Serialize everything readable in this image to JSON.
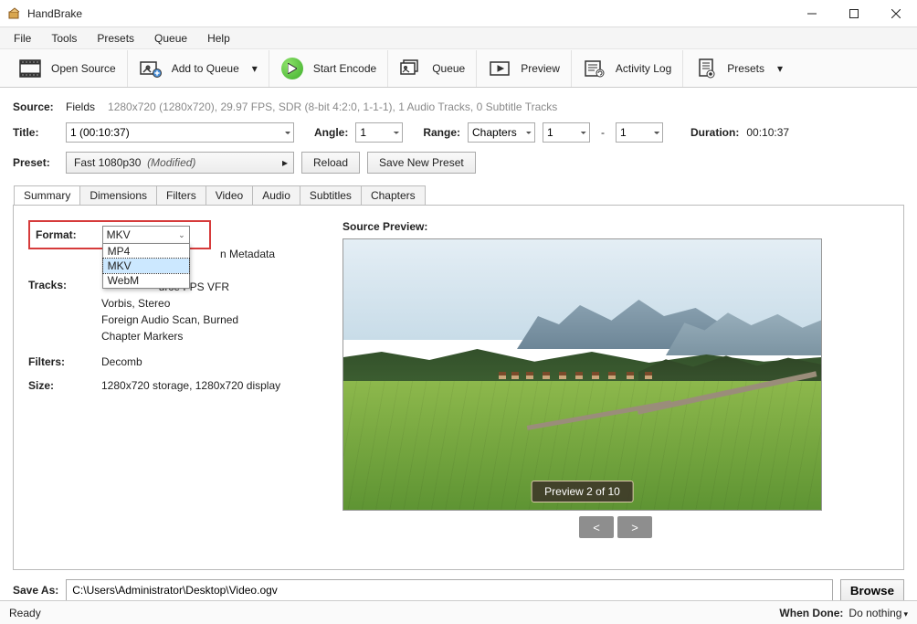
{
  "app": {
    "name": "HandBrake"
  },
  "menu": {
    "file": "File",
    "tools": "Tools",
    "presets": "Presets",
    "queue": "Queue",
    "help": "Help"
  },
  "toolbar": {
    "open_source": "Open Source",
    "add_to_queue": "Add to Queue",
    "start_encode": "Start Encode",
    "queue": "Queue",
    "preview": "Preview",
    "activity_log": "Activity Log",
    "presets": "Presets"
  },
  "source": {
    "label": "Source:",
    "name": "Fields",
    "info": "1280x720 (1280x720), 29.97 FPS, SDR (8-bit 4:2:0, 1-1-1), 1 Audio Tracks, 0 Subtitle Tracks"
  },
  "title_row": {
    "title_label": "Title:",
    "title_value": "1  (00:10:37)",
    "angle_label": "Angle:",
    "angle_value": "1",
    "range_label": "Range:",
    "range_type": "Chapters",
    "range_from": "1",
    "range_sep": "-",
    "range_to": "1",
    "duration_label": "Duration:",
    "duration_value": "00:10:37"
  },
  "preset": {
    "label": "Preset:",
    "name": "Fast 1080p30",
    "modified": "(Modified)",
    "reload": "Reload",
    "save_new": "Save New Preset"
  },
  "tabs": {
    "summary": "Summary",
    "dimensions": "Dimensions",
    "filters": "Filters",
    "video": "Video",
    "audio": "Audio",
    "subtitles": "Subtitles",
    "chapters": "Chapters"
  },
  "summary": {
    "format_label": "Format:",
    "format_value": "MKV",
    "format_options": {
      "mp4": "MP4",
      "mkv": "MKV",
      "webm": "WebM"
    },
    "passthru_metadata_partial": "n Metadata",
    "tracks_label": "Tracks:",
    "tracks_line1_partial": "urce FPS VFR",
    "tracks_line2": "Vorbis, Stereo",
    "tracks_line3": "Foreign Audio Scan, Burned",
    "tracks_line4": "Chapter Markers",
    "filters_label": "Filters:",
    "filters_value": "Decomb",
    "size_label": "Size:",
    "size_value": "1280x720 storage, 1280x720 display",
    "preview_title": "Source Preview:",
    "preview_badge": "Preview 2 of 10",
    "nav_prev": "<",
    "nav_next": ">"
  },
  "save": {
    "label": "Save As:",
    "path": "C:\\Users\\Administrator\\Desktop\\Video.ogv",
    "browse": "Browse"
  },
  "status": {
    "ready": "Ready",
    "when_done_label": "When Done:",
    "when_done_value": "Do nothing"
  }
}
